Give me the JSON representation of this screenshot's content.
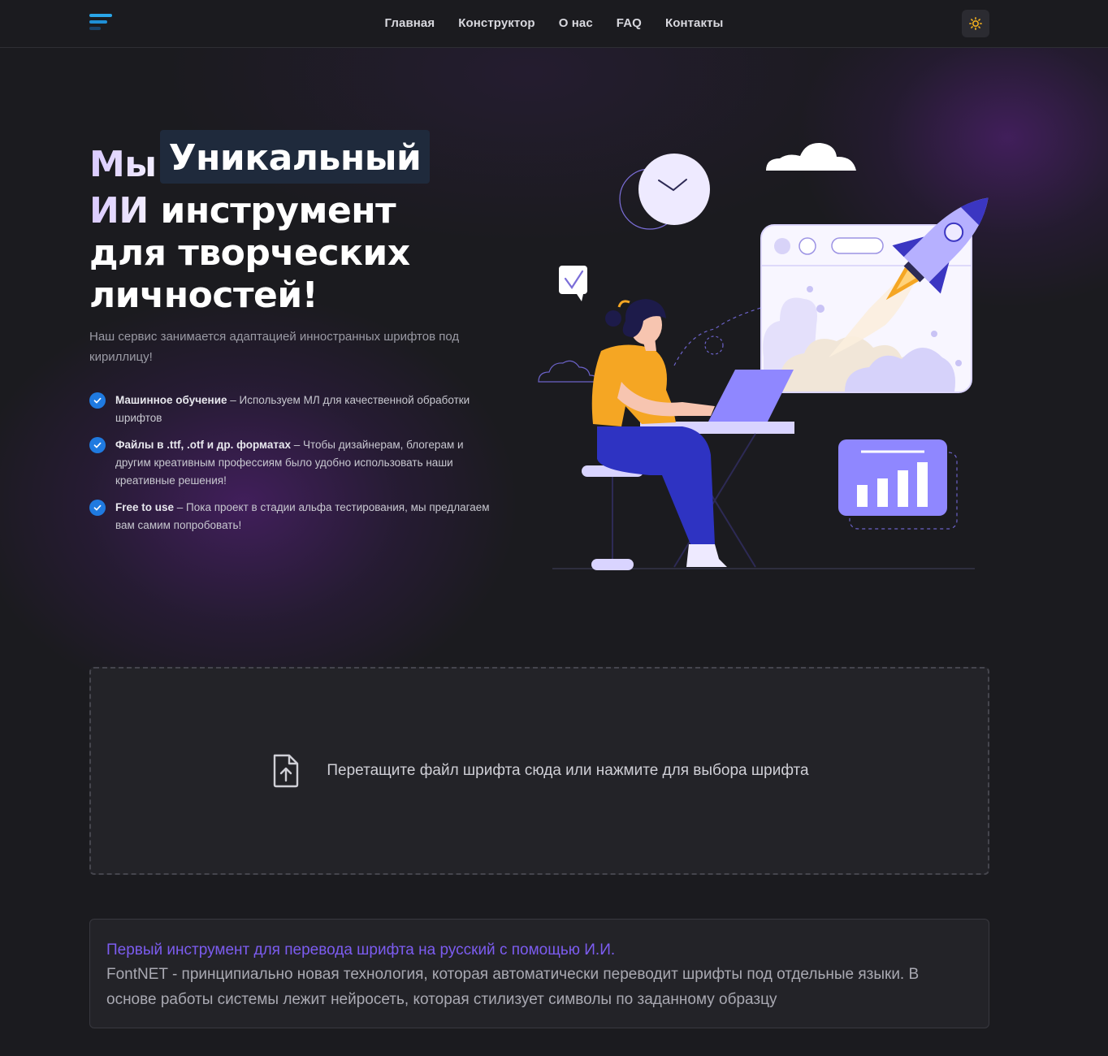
{
  "nav": {
    "links": [
      "Главная",
      "Конструктор",
      "О нас",
      "FAQ",
      "Контакты"
    ],
    "theme_icon": "sun-icon"
  },
  "hero": {
    "title_word1": "Мы",
    "title_highlight": "Уникальный",
    "title_line2_a": "ИИ",
    "title_line2_b": "инструмент",
    "title_line3": "для творческих",
    "title_line4": "личностей!",
    "subtitle": "Наш сервис занимается адаптацией инностранных шрифтов под кириллицу!"
  },
  "features": [
    {
      "bold": "Машинное обучение",
      "text": " – Используем МЛ для качественной обработки шрифтов"
    },
    {
      "bold": "Файлы в .ttf, .otf и др. форматах",
      "text": " – Чтобы дизайнерам, блогерам и другим креативным профессиям было удобно использовать наши креативные решения!"
    },
    {
      "bold": "Free to use",
      "text": " – Пока проект в стадии альфа тестирования, мы предлагаем вам самим попробовать!"
    }
  ],
  "dropzone": {
    "icon": "file-upload-icon",
    "text": "Перетащите файл шрифта сюда или нажмите для выбора шрифта"
  },
  "info": {
    "title": "Первый инструмент для перевода шрифта на русский с помощью И.И.",
    "text": "FontNET - принципиально новая технология, которая автоматически переводит шрифты под отдельные языки. В основе работы системы лежит нейросеть, которая стилизует символы по заданному образцу"
  },
  "colors": {
    "background": "#1b1b1f",
    "accent_blue": "#1f7ae0",
    "accent_purple": "#7c5cf0",
    "card": "#232328"
  }
}
